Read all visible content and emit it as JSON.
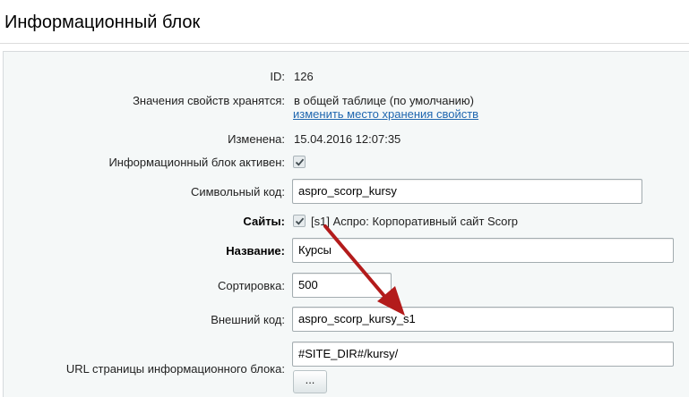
{
  "page": {
    "title": "Информационный блок"
  },
  "fields": {
    "id": {
      "label": "ID:",
      "value": "126"
    },
    "storage": {
      "label": "Значения свойств хранятся:",
      "value": "в общей таблице (по умолчанию)",
      "link": "изменить место хранения свойств"
    },
    "changed": {
      "label": "Изменена:",
      "value": "15.04.2016 12:07:35"
    },
    "active": {
      "label": "Информационный блок активен:",
      "checked": true
    },
    "code": {
      "label": "Символьный код:",
      "value": "aspro_scorp_kursy"
    },
    "sites": {
      "label": "Сайты:",
      "checked": true,
      "value": "[s1] Аспро: Корпоративный сайт Scorp"
    },
    "name": {
      "label": "Название:",
      "value": "Курсы"
    },
    "sort": {
      "label": "Сортировка:",
      "value": "500"
    },
    "external_code": {
      "label": "Внешний код:",
      "value": "aspro_scorp_kursy_s1"
    },
    "url": {
      "label": "URL страницы информационного блока:",
      "value": "#SITE_DIR#/kursy/",
      "button": "..."
    }
  },
  "annotation": {
    "arrow_color": "#b31b1b"
  }
}
